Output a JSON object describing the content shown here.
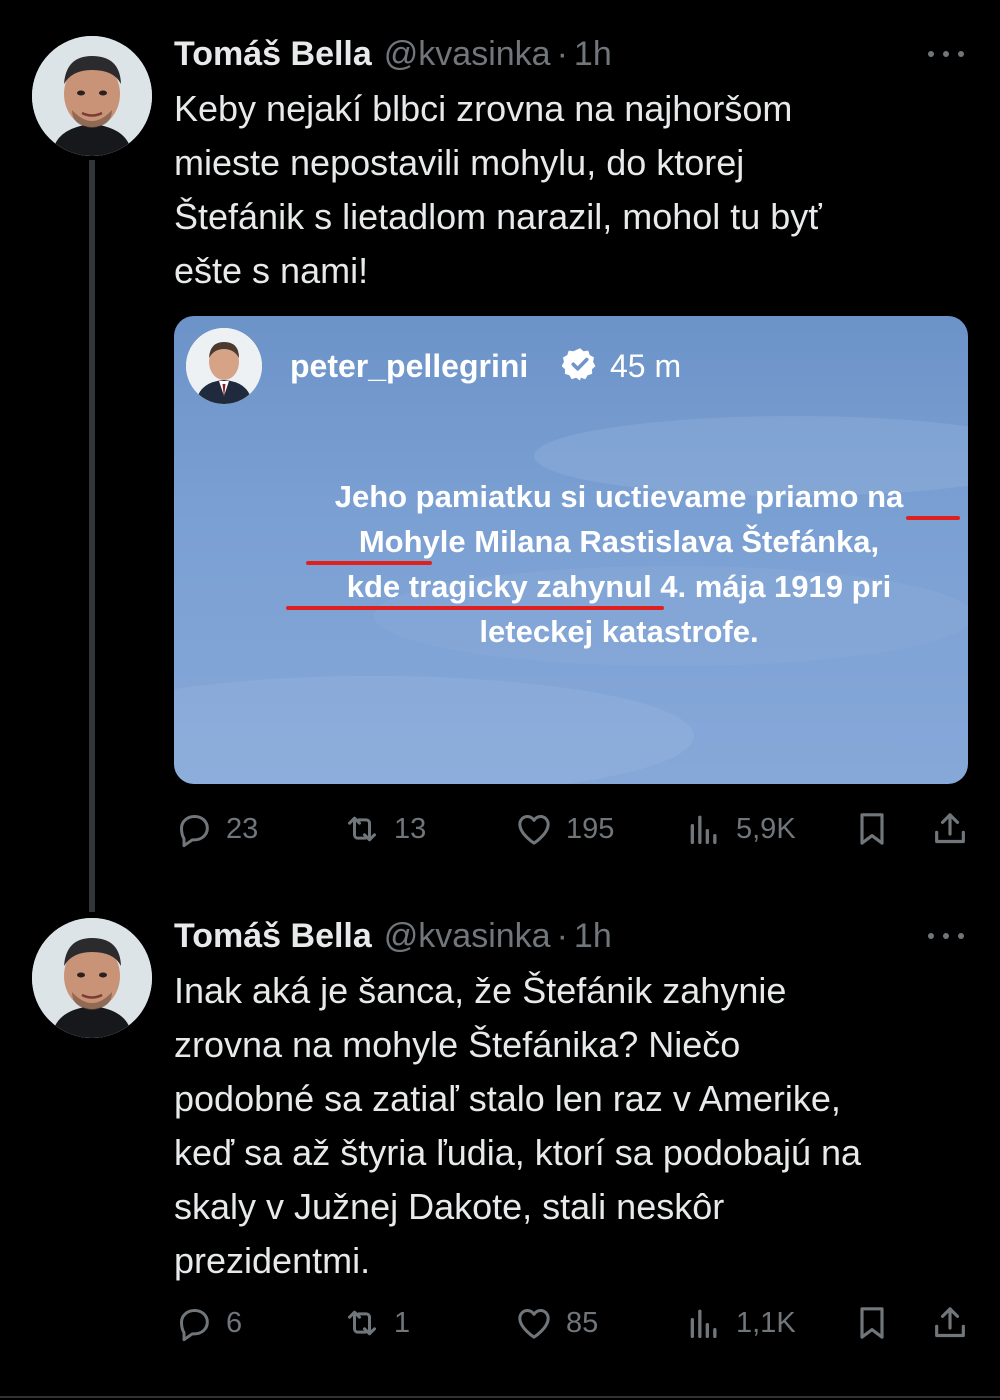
{
  "tweets": [
    {
      "author": "Tomáš Bella",
      "handle": "@kvasinka",
      "separator": "·",
      "time": "1h",
      "text": "Keby nejakí blbci zrovna na najhoršom\nmieste nepostavili mohylu, do ktorej\nŠtefánik s lietadlom narazil, mohol tu byť\nešte s nami!",
      "quote": {
        "username": "peter_pellegrini",
        "time": "45 m",
        "caption_lines": [
          "Jeho pamiatku si uctievame priamo na",
          "Mohyle Milana Rastislava Štefánka,",
          "kde tragicky zahynul 4. mája 1919 pri",
          "leteckej katastrofe."
        ]
      },
      "actions": {
        "replies": "23",
        "reposts": "13",
        "likes": "195",
        "views": "5,9K"
      }
    },
    {
      "author": "Tomáš Bella",
      "handle": "@kvasinka",
      "separator": "·",
      "time": "1h",
      "text": "Inak aká je šanca, že Štefánik zahynie\nzrovna na mohyle Štefánika? Niečo\npodobné sa zatiaľ stalo len raz v Amerike,\nkeď sa až štyria ľudia, ktorí sa podobajú na\nskaly v Južnej Dakote, stali neskôr\nprezidentmi.",
      "actions": {
        "replies": "6",
        "reposts": "1",
        "likes": "85",
        "views": "1,1K"
      }
    }
  ],
  "colors": {
    "background": "#000000",
    "text": "#e7e9ea",
    "muted": "#71767b",
    "underline": "#e0201e",
    "quote_bg": "#7a9fd2"
  },
  "icons": [
    "reply-icon",
    "repost-icon",
    "like-icon",
    "views-icon",
    "bookmark-icon",
    "share-icon",
    "verified-icon",
    "more-icon"
  ]
}
